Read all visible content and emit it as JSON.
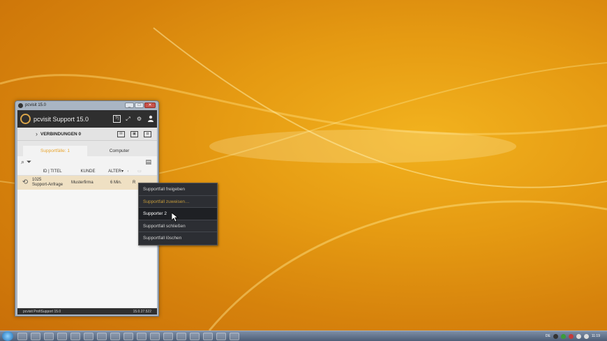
{
  "window": {
    "title": "pcvisit 15.0",
    "minimize": "_",
    "maximize": "□",
    "close": "✕"
  },
  "header": {
    "app_name": "pcvisit Support 15.0",
    "help_icon_label": "?|",
    "icons": [
      "help-icon",
      "expand-icon",
      "gear-icon",
      "user-icon"
    ]
  },
  "connections": {
    "chevron": "›",
    "label": "VERBINDUNGEN 0"
  },
  "tabs": [
    {
      "label": "Supportfälle: 1",
      "active": true
    },
    {
      "label": "Computer",
      "active": false
    }
  ],
  "table": {
    "headers": {
      "id_title": "ID | TITEL",
      "customer": "KUNDE",
      "age": "ALTER▾"
    },
    "rows": [
      {
        "id": "1025",
        "title": "Support-Anfrage",
        "customer": "Musterfirma",
        "age": "6 Min.",
        "extra": "R"
      }
    ]
  },
  "statusbar": {
    "product": "pcvisit ProfiSupport 15.0",
    "version": "15.0.27.522"
  },
  "context_menu": {
    "items": [
      {
        "label": "Supportfall freigeben",
        "state": "normal"
      },
      {
        "label": "Supportfall zuweisen…",
        "state": "disabled"
      },
      {
        "label": "Supporter 2",
        "state": "hover"
      },
      {
        "label": "Supportfall schließen",
        "state": "normal"
      },
      {
        "label": "Supportfall löschen",
        "state": "normal"
      }
    ]
  },
  "taskbar": {
    "language": "DE",
    "clock": "11:19"
  },
  "colors": {
    "accent": "#e8a52f",
    "header_bg": "#2f2f2f",
    "menu_bg": "#2c2e33"
  }
}
